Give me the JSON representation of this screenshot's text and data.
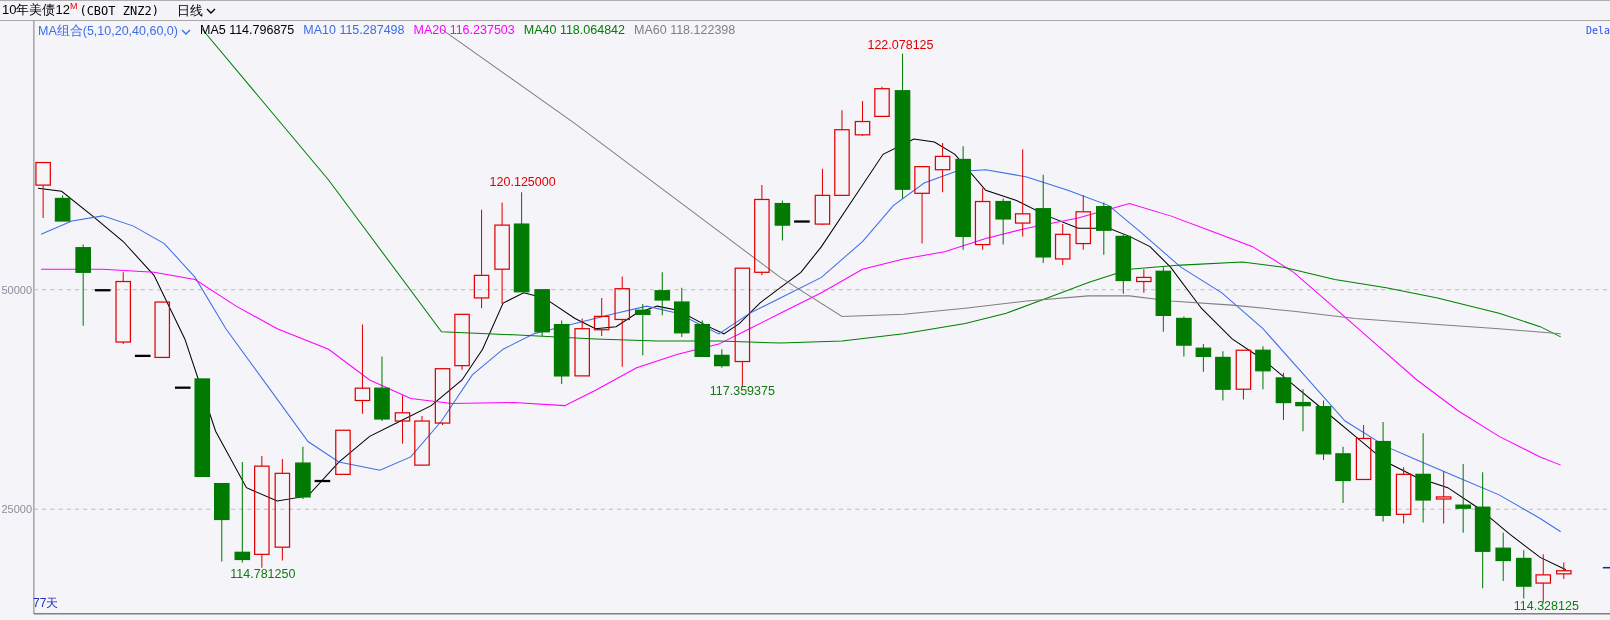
{
  "header": {
    "title": "10年美债12",
    "title_mark": "M",
    "contract": "(CBOT ZNZ2)",
    "period": "日线"
  },
  "legend": {
    "selector": "MA组合(5,10,20,40,60,0)",
    "averages": [
      {
        "name": "MA5",
        "value": "114.796875",
        "color": "#000000"
      },
      {
        "name": "MA10",
        "value": "115.287498",
        "color": "#3c6ee6"
      },
      {
        "name": "MA20",
        "value": "116.237503",
        "color": "#ff00ff"
      },
      {
        "name": "MA40",
        "value": "118.064842",
        "color": "#008000"
      },
      {
        "name": "MA60",
        "value": "118.122398",
        "color": "#808080"
      }
    ]
  },
  "delay_badge": "Dela",
  "axis_labels": [
    "50000",
    "25000"
  ],
  "price_labels": [
    {
      "kind": "high",
      "text": "122.078125"
    },
    {
      "kind": "high",
      "text": "120.125000"
    },
    {
      "kind": "low",
      "text": "117.359375"
    },
    {
      "kind": "low",
      "text": "114.781250"
    },
    {
      "kind": "low",
      "text": "114.328125"
    }
  ],
  "period_count": "77天"
}
